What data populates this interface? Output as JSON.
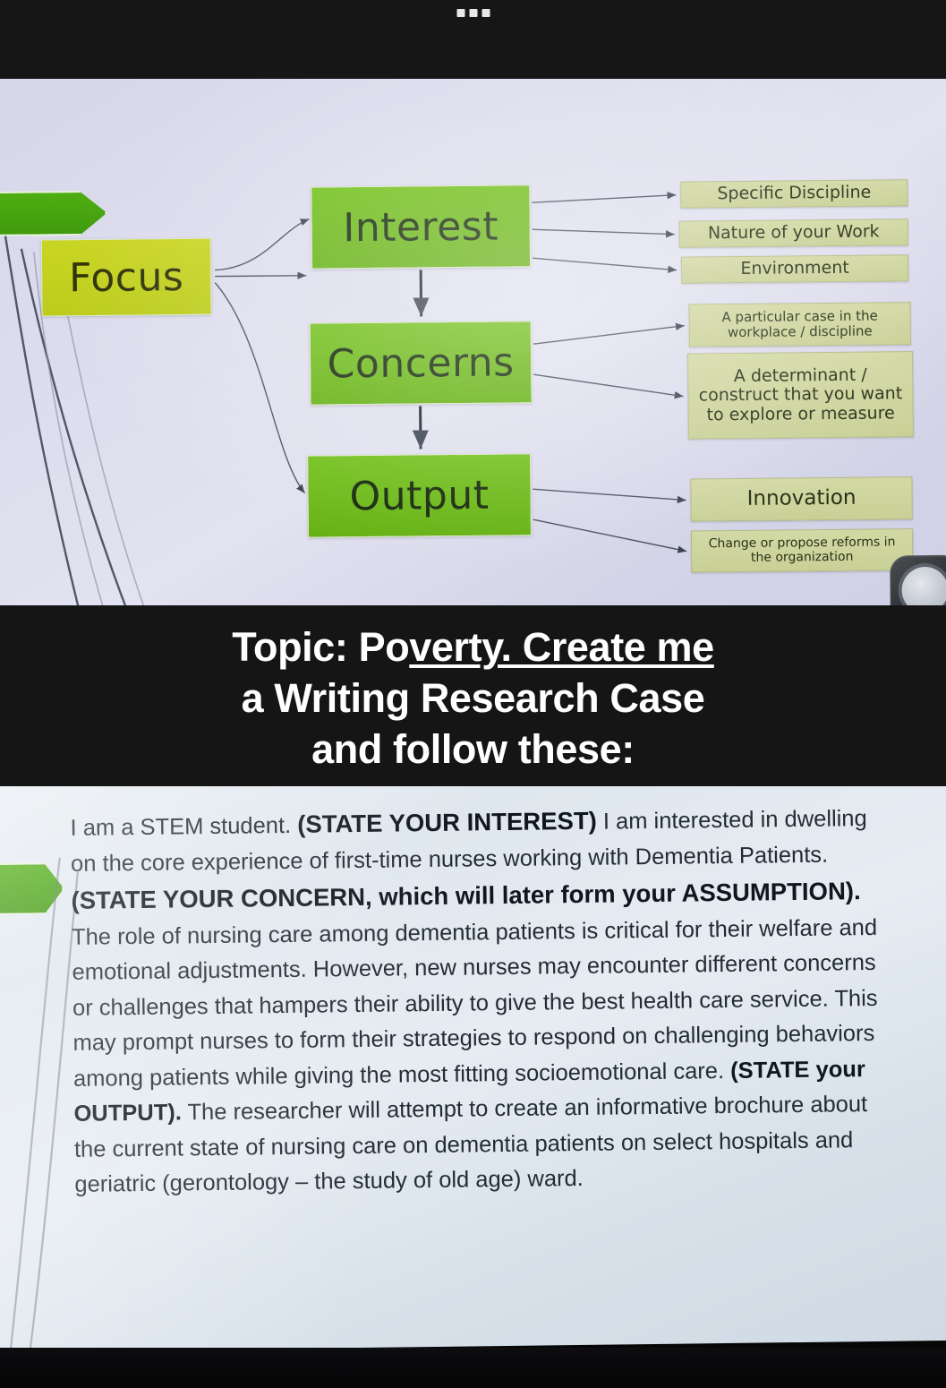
{
  "topbar": {
    "menu_icon": "three-dots-icon"
  },
  "slide": {
    "nodes": {
      "focus": "Focus",
      "interest": "Interest",
      "concerns": "Concerns",
      "output": "Output"
    },
    "interest_outputs": [
      "Specific Discipline",
      "Nature of your Work",
      "Environment"
    ],
    "concerns_outputs": [
      "A particular case in the workplace / discipline",
      "A determinant / construct that you want to explore or measure"
    ],
    "output_outputs": [
      "Innovation",
      "Change or propose reforms in the organization"
    ],
    "colors": {
      "focus_box": "#c9d522",
      "main_box": "#72c01a",
      "leaf_box": "#d3d9a4",
      "arrow_green": "#4fae12",
      "slide_bg": "#dcdced"
    }
  },
  "caption": {
    "line1_a": "Topic: Po",
    "line1_b": "verty. Create me",
    "line2": "a Writing Research Case",
    "line3": "and follow these:"
  },
  "document": {
    "paragraph": {
      "p1": "I am a STEM student. ",
      "k1": "(STATE YOUR INTEREST)",
      "p2": " I am interested in dwelling on the core experience of first-time nurses working with Dementia Patients. ",
      "k2": "(STATE YOUR CONCERN, which will later form your ASSUMPTION).",
      "p3": " The role of nursing care among dementia patients is critical for their welfare and emotional adjustments. However, new nurses may encounter different concerns or challenges that hampers their ability to give the best health care service. This may prompt nurses to form their strategies to respond on challenging behaviors among patients while giving the most fitting socioemotional care. ",
      "k3": "(STATE your OUTPUT).",
      "p4": " The researcher will attempt to create an informative brochure about the current state of nursing care on dementia patients on select hospitals and geriatric (gerontology – the study of old age) ward."
    }
  }
}
